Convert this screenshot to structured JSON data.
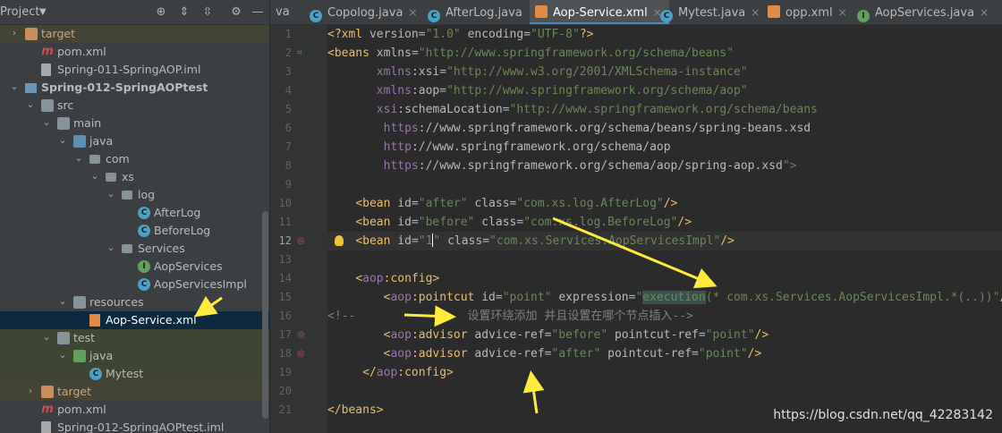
{
  "sidebar": {
    "title": "Project",
    "tree": [
      {
        "label": "target",
        "indent": 0,
        "arrow": "›",
        "icon": "folder-or",
        "style": "excl"
      },
      {
        "label": "pom.xml",
        "indent": 1,
        "arrow": "",
        "icon": "maven"
      },
      {
        "label": "Spring-011-SpringAOP.iml",
        "indent": 1,
        "arrow": "",
        "icon": "file"
      },
      {
        "label": "Spring-012-SpringAOPtest",
        "indent": 0,
        "arrow": "⌄",
        "icon": "module",
        "bold": true
      },
      {
        "label": "src",
        "indent": 1,
        "arrow": "⌄",
        "icon": "folder"
      },
      {
        "label": "main",
        "indent": 2,
        "arrow": "⌄",
        "icon": "folder"
      },
      {
        "label": "java",
        "indent": 3,
        "arrow": "⌄",
        "icon": "folder-bl"
      },
      {
        "label": "com",
        "indent": 4,
        "arrow": "⌄",
        "icon": "package"
      },
      {
        "label": "xs",
        "indent": 5,
        "arrow": "⌄",
        "icon": "package"
      },
      {
        "label": "log",
        "indent": 6,
        "arrow": "⌄",
        "icon": "package"
      },
      {
        "label": "AfterLog",
        "indent": 7,
        "arrow": "",
        "icon": "class"
      },
      {
        "label": "BeforeLog",
        "indent": 7,
        "arrow": "",
        "icon": "class"
      },
      {
        "label": "Services",
        "indent": 6,
        "arrow": "⌄",
        "icon": "package"
      },
      {
        "label": "AopServices",
        "indent": 7,
        "arrow": "",
        "icon": "interface"
      },
      {
        "label": "AopServicesImpl",
        "indent": 7,
        "arrow": "",
        "icon": "class"
      },
      {
        "label": "resources",
        "indent": 3,
        "arrow": "⌄",
        "icon": "folder"
      },
      {
        "label": "Aop-Service.xml",
        "indent": 4,
        "arrow": "",
        "icon": "xml",
        "style": "sel"
      },
      {
        "label": "test",
        "indent": 2,
        "arrow": "⌄",
        "icon": "folder",
        "style": "test"
      },
      {
        "label": "java",
        "indent": 3,
        "arrow": "⌄",
        "icon": "folder-gr",
        "style": "test"
      },
      {
        "label": "Mytest",
        "indent": 4,
        "arrow": "",
        "icon": "class",
        "style": "test"
      },
      {
        "label": "target",
        "indent": 1,
        "arrow": "›",
        "icon": "folder-or",
        "style": "excl"
      },
      {
        "label": "pom.xml",
        "indent": 1,
        "arrow": "",
        "icon": "maven"
      },
      {
        "label": "Spring-012-SpringAOPtest.iml",
        "indent": 1,
        "arrow": "",
        "icon": "file"
      }
    ]
  },
  "tabs": [
    {
      "label": "va",
      "icon": "",
      "active": false
    },
    {
      "label": "Copolog.java",
      "icon": "class",
      "active": false
    },
    {
      "label": "AfterLog.java",
      "icon": "class",
      "active": false
    },
    {
      "label": "Aop-Service.xml",
      "icon": "xml",
      "active": true
    },
    {
      "label": "Mytest.java",
      "icon": "class",
      "active": false
    },
    {
      "label": "opp.xml",
      "icon": "xml",
      "active": false
    },
    {
      "label": "AopServices.java",
      "icon": "interface",
      "active": false
    }
  ],
  "editor": {
    "current_line": 12,
    "line_numbers": [
      "1",
      "2",
      "3",
      "4",
      "5",
      "6",
      "7",
      "8",
      "9",
      "10",
      "11",
      "12",
      "13",
      "14",
      "15",
      "16",
      "17",
      "18",
      "19",
      "20",
      "21"
    ],
    "lines": [
      "<?xml version=\"1.0\" encoding=\"UTF-8\"?>",
      "<beans xmlns=\"http://www.springframework.org/schema/beans\"",
      "       xmlns:xsi=\"http://www.w3.org/2001/XMLSchema-instance\"",
      "       xmlns:aop=\"http://www.springframework.org/schema/aop\"",
      "       xsi:schemaLocation=\"http://www.springframework.org/schema/beans",
      "        https://www.springframework.org/schema/beans/spring-beans.xsd",
      "        http://www.springframework.org/schema/aop",
      "        https://www.springframework.org/schema/aop/spring-aop.xsd\">",
      "",
      "    <bean id=\"after\" class=\"com.xs.log.AfterLog\"/>",
      "    <bean id=\"before\" class=\"com.xs.log.BeforeLog\"/>",
      "    <bean id=\"1\" class=\"com.xs.Services.AopServicesImpl\"/>",
      "",
      "    <aop:config>",
      "        <aop:pointcut id=\"point\" expression=\"execution(* com.xs.Services.AopServicesImpl.*(..))\"/>",
      "<!--                设置环绕添加 并且设置在哪个节点插入-->",
      "        <aop:advisor advice-ref=\"before\" pointcut-ref=\"point\"/>",
      "        <aop:advisor advice-ref=\"after\" pointcut-ref=\"point\"/>",
      "     </aop:config>",
      "",
      "</beans>"
    ]
  },
  "watermark": "https://blog.csdn.net/qq_42283142",
  "colors": {
    "tag": "#e8bf6a",
    "value": "#6a8759",
    "namespace": "#9876aa",
    "comment": "#808080",
    "annotation_arrow": "#ffeb3b"
  }
}
